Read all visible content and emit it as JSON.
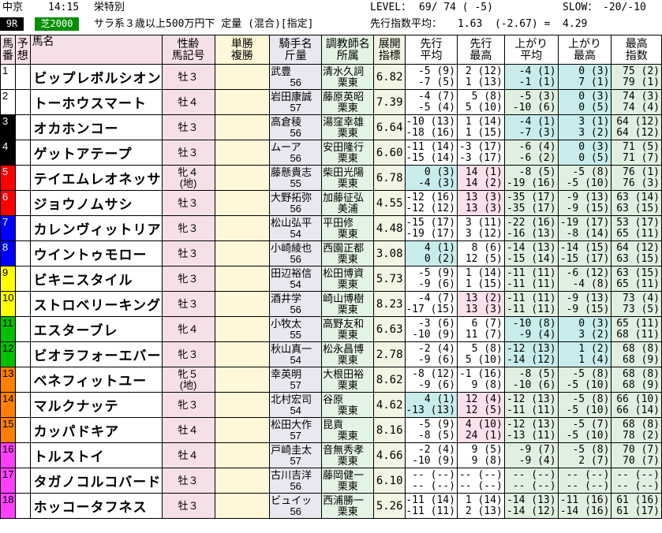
{
  "header": {
    "venue": "中京",
    "time": "14:15",
    "race_name": "栄特別",
    "level_label": "LEVEL：",
    "level_value": "69/ 74 ( -5)",
    "slow_label": "SLOW：",
    "slow_value": "-20/-10",
    "race_no": "9R",
    "course": "芝2000",
    "conditions": "サラ系３歳以上500万円下 定量 (混合)[指定]",
    "pace_label": "先行指数平均：",
    "pace_value": "1.63  (-2.67) =  4.29"
  },
  "columns": [
    "馬番",
    "予想",
    "馬名",
    "性齢 馬記号",
    "単勝 複勝",
    "騎手名 斤量",
    "調教師名 所属",
    "展開 指標",
    "先行 平均",
    "先行 最高",
    "上がり 平均",
    "上がり 最高",
    "最高 指数"
  ],
  "col_labels": {
    "c1": "馬",
    "c1b": "番",
    "c2": "予",
    "c2b": "想",
    "c3": "馬名",
    "c4": "性齢",
    "c4b": "馬記号",
    "c5": "単勝",
    "c5b": "複勝",
    "c6": "騎手名",
    "c6b": "斤量",
    "c7": "調教師名",
    "c7b": "所属",
    "c8": "展開",
    "c8b": "指標",
    "c9": "先行",
    "c9b": "平均",
    "c10": "先行",
    "c10b": "最高",
    "c11": "上がり",
    "c11b": "平均",
    "c12": "上がり",
    "c12b": "最高",
    "c13": "最高",
    "c13b": "指数"
  },
  "rows": [
    {
      "no": "1",
      "color": "#ffffff",
      "name": "ビップレボルシオン",
      "sex": "牡３",
      "sex2": "",
      "jockey": "武豊",
      "weight": "56",
      "trainer": "清水久詞",
      "belong": "栗東",
      "idx": "6.82",
      "sa1": "-5 (9)",
      "sa2": "-7 (5)",
      "sm1": "2 (12)",
      "sm2": "1 (13)",
      "ua1": "-4 (1)",
      "ua2": "-1 (1)",
      "um1": "0 (3)",
      "um2": "7 (1)",
      "mx1": "75 (2)",
      "mx2": "79 (1)"
    },
    {
      "no": "2",
      "color": "#ffffff",
      "name": "トーホウスマート",
      "sex": "牡４",
      "sex2": "",
      "jockey": "岩田康誠",
      "weight": "57",
      "trainer": "藤原英昭",
      "belong": "栗東",
      "idx": "7.39",
      "sa1": "-4 (7)",
      "sa2": "-5 (4)",
      "sm1": "5 (8)",
      "sm2": "5 (10)",
      "ua1": "-5 (3)",
      "ua2": "-10 (6)",
      "um1": "0 (3)",
      "um2": "0 (5)",
      "mx1": "74 (3)",
      "mx2": "74 (4)"
    },
    {
      "no": "3",
      "color": "#000000",
      "name": "オカホンコー",
      "sex": "牡３",
      "sex2": "",
      "jockey": "高倉稜",
      "weight": "56",
      "trainer": "湯窪幸雄",
      "belong": "栗東",
      "idx": "6.64",
      "sa1": "-10 (13)",
      "sa2": "-18 (16)",
      "sm1": "1 (14)",
      "sm2": "1 (15)",
      "ua1": "-4 (1)",
      "ua2": "-7 (3)",
      "um1": "3 (1)",
      "um2": "3 (2)",
      "mx1": "64 (12)",
      "mx2": "64 (12)"
    },
    {
      "no": "4",
      "color": "#000000",
      "name": "ゲットアテープ",
      "sex": "牡３",
      "sex2": "",
      "jockey": "ムーア",
      "weight": "56",
      "trainer": "安田隆行",
      "belong": "栗東",
      "idx": "6.60",
      "sa1": "-11 (14)",
      "sa2": "-15 (14)",
      "sm1": "-3 (17)",
      "sm2": "-3 (17)",
      "ua1": "-6 (4)",
      "ua2": "-6 (2)",
      "um1": "0 (3)",
      "um2": "0 (5)",
      "mx1": "71 (5)",
      "mx2": "71 (7)"
    },
    {
      "no": "5",
      "color": "#ff0000",
      "name": "テイエムレオネッサ",
      "sex": "牝４",
      "sex2": "(地)",
      "jockey": "藤懸貴志",
      "weight": "55",
      "trainer": "柴田光陽",
      "belong": "栗東",
      "idx": "6.78",
      "sa1": "0 (3)",
      "sa2": "-4 (3)",
      "sm1": "14 (1)",
      "sm2": "14 (2)",
      "ua1": "-8 (5)",
      "ua2": "-19 (16)",
      "um1": "-5 (8)",
      "um2": "-5 (10)",
      "mx1": "76 (1)",
      "mx2": "76 (3)"
    },
    {
      "no": "6",
      "color": "#ff0000",
      "name": "ジョウノムサシ",
      "sex": "牡３",
      "sex2": "",
      "jockey": "大野拓弥",
      "weight": "56",
      "trainer": "加藤征弘",
      "belong": "美浦",
      "idx": "4.55",
      "sa1": "-12 (16)",
      "sa2": "-12 (12)",
      "sm1": "13 (3)",
      "sm2": "13 (3)",
      "ua1": "-35 (17)",
      "ua2": "-35 (17)",
      "um1": "-9 (13)",
      "um2": "-9 (15)",
      "mx1": "63 (14)",
      "mx2": "63 (15)"
    },
    {
      "no": "7",
      "color": "#0000ff",
      "name": "カレンヴィットリア",
      "sex": "牝３",
      "sex2": "",
      "jockey": "松山弘平",
      "weight": "54",
      "trainer": "平田修",
      "belong": "栗東",
      "idx": "4.48",
      "sa1": "-15 (17)",
      "sa2": "-19 (17)",
      "sm1": "3 (11)",
      "sm2": "3 (12)",
      "ua1": "-22 (16)",
      "ua2": "-16 (13)",
      "um1": "-19 (17)",
      "um2": "-8 (14)",
      "mx1": "53 (17)",
      "mx2": "65 (11)"
    },
    {
      "no": "8",
      "color": "#0000ff",
      "name": "ウイントゥモロー",
      "sex": "牡３",
      "sex2": "",
      "jockey": "小崎綾也",
      "weight": "56",
      "trainer": "西園正都",
      "belong": "栗東",
      "idx": "3.08",
      "sa1": "4 (1)",
      "sa2": "0 (2)",
      "sm1": "8 (6)",
      "sm2": "12 (5)",
      "ua1": "-14 (13)",
      "ua2": "-15 (14)",
      "um1": "-14 (15)",
      "um2": "-15 (17)",
      "mx1": "64 (12)",
      "mx2": "63 (15)"
    },
    {
      "no": "9",
      "color": "#ffff00",
      "name": "ビキニスタイル",
      "sex": "牝３",
      "sex2": "",
      "jockey": "田辺裕信",
      "weight": "54",
      "trainer": "松田博資",
      "belong": "栗東",
      "idx": "5.73",
      "sa1": "-5 (9)",
      "sa2": "-9 (6)",
      "sm1": "1 (14)",
      "sm2": "1 (15)",
      "ua1": "-11 (11)",
      "ua2": "-11 (11)",
      "um1": "-6 (12)",
      "um2": "-4 (8)",
      "mx1": "63 (15)",
      "mx2": "65 (11)"
    },
    {
      "no": "10",
      "color": "#ffff00",
      "name": "ストロベリーキング",
      "sex": "牡３",
      "sex2": "",
      "jockey": "酒井学",
      "weight": "56",
      "trainer": "崎山博樹",
      "belong": "栗東",
      "idx": "8.23",
      "sa1": "-4 (7)",
      "sa2": "-17 (15)",
      "sm1": "13 (2)",
      "sm2": "13 (3)",
      "ua1": "-11 (11)",
      "ua2": "-11 (11)",
      "um1": "-9 (13)",
      "um2": "-9 (15)",
      "mx1": "73 (4)",
      "mx2": "73 (5)"
    },
    {
      "no": "11",
      "color": "#00c000",
      "name": "エスターブレ",
      "sex": "牝４",
      "sex2": "",
      "jockey": "小牧太",
      "weight": "55",
      "trainer": "高野友和",
      "belong": "栗東",
      "idx": "6.63",
      "sa1": "-3 (6)",
      "sa2": "-10 (9)",
      "sm1": "6 (7)",
      "sm2": "11 (7)",
      "ua1": "-10 (8)",
      "ua2": "-9 (4)",
      "um1": "0 (3)",
      "um2": "3 (2)",
      "mx1": "65 (11)",
      "mx2": "68 (11)"
    },
    {
      "no": "12",
      "color": "#00c000",
      "name": "ビオラフォーエバー",
      "sex": "牝３",
      "sex2": "",
      "jockey": "秋山真一",
      "weight": "54",
      "trainer": "松永昌博",
      "belong": "栗東",
      "idx": "2.78",
      "sa1": "-2 (4)",
      "sa2": "-9 (6)",
      "sm1": "5 (8)",
      "sm2": "5 (10)",
      "ua1": "-12 (13)",
      "ua2": "-14 (12)",
      "um1": "1 (2)",
      "um2": "1 (4)",
      "mx1": "68 (8)",
      "mx2": "68 (9)"
    },
    {
      "no": "13",
      "color": "#ff8000",
      "name": "ベネフィットユー",
      "sex": "牝５",
      "sex2": "(地)",
      "jockey": "幸英明",
      "weight": "57",
      "trainer": "大根田裕",
      "belong": "栗東",
      "idx": "8.62",
      "sa1": "-8 (12)",
      "sa2": "-9 (6)",
      "sm1": "-1 (16)",
      "sm2": "9 (8)",
      "ua1": "-8 (5)",
      "ua2": "-10 (6)",
      "um1": "-5 (8)",
      "um2": "-5 (10)",
      "mx1": "68 (8)",
      "mx2": "68 (9)"
    },
    {
      "no": "14",
      "color": "#ff8000",
      "name": "マルクナッテ",
      "sex": "牝３",
      "sex2": "",
      "jockey": "北村宏司",
      "weight": "54",
      "trainer": "谷原",
      "belong": "栗東",
      "idx": "4.62",
      "sa1": "4 (1)",
      "sa2": "-13 (13)",
      "sm1": "12 (4)",
      "sm2": "12 (5)",
      "ua1": "-12 (13)",
      "ua2": "-11 (11)",
      "um1": "-5 (8)",
      "um2": "-5 (10)",
      "mx1": "66 (10)",
      "mx2": "66 (14)"
    },
    {
      "no": "15",
      "color": "#ff8000",
      "name": "カッパドキア",
      "sex": "牡４",
      "sex2": "",
      "jockey": "松田大作",
      "weight": "57",
      "trainer": "昆貢",
      "belong": "栗東",
      "idx": "8.16",
      "sa1": "-5 (9)",
      "sa2": "-8 (5)",
      "sm1": "4 (10)",
      "sm2": "24 (1)",
      "ua1": "-12 (13)",
      "ua2": "-13 (11)",
      "um1": "-5 (7)",
      "um2": "-5 (10)",
      "mx1": "68 (8)",
      "mx2": "78 (2)"
    },
    {
      "no": "16",
      "color": "#ff40ff",
      "name": "トルストイ",
      "sex": "牡４",
      "sex2": "",
      "jockey": "戸崎圭太",
      "weight": "57",
      "trainer": "音無秀孝",
      "belong": "栗東",
      "idx": "4.66",
      "sa1": "-2 (4)",
      "sa2": "-10 (9)",
      "sm1": "9 (5)",
      "sm2": "9 (8)",
      "ua1": "-9 (7)",
      "ua2": "-9 (4)",
      "um1": "-5 (8)",
      "um2": "2 (7)",
      "mx1": "70 (7)",
      "mx2": "70 (7)"
    },
    {
      "no": "17",
      "color": "#ff40ff",
      "name": "タガノコルコバード",
      "sex": "牡３",
      "sex2": "",
      "jockey": "古川吉洋",
      "weight": "56",
      "trainer": "藤岡健一",
      "belong": "栗東",
      "idx": "6.10",
      "sa1": "-- (--)",
      "sa2": "-- (--)",
      "sm1": "-- (--)",
      "sm2": "-- (--)",
      "ua1": "-- (--)",
      "ua2": "-- (--)",
      "um1": "-- (--)",
      "um2": "-- (--)",
      "mx1": "-- (--)",
      "mx2": "-- (--)"
    },
    {
      "no": "18",
      "color": "#ff40ff",
      "name": "ホッコータフネス",
      "sex": "牡３",
      "sex2": "",
      "jockey": "ビュイッ",
      "weight": "56",
      "trainer": "西浦勝一",
      "belong": "栗東",
      "idx": "5.26",
      "sa1": "-11 (14)",
      "sa2": "-11 (11)",
      "sm1": "1 (14)",
      "sm2": "2 (13)",
      "ua1": "-14 (13)",
      "ua2": "-14 (12)",
      "um1": "-11 (16)",
      "um2": "-14 (16)",
      "mx1": "61 (16)",
      "mx2": "61 (17)"
    }
  ]
}
